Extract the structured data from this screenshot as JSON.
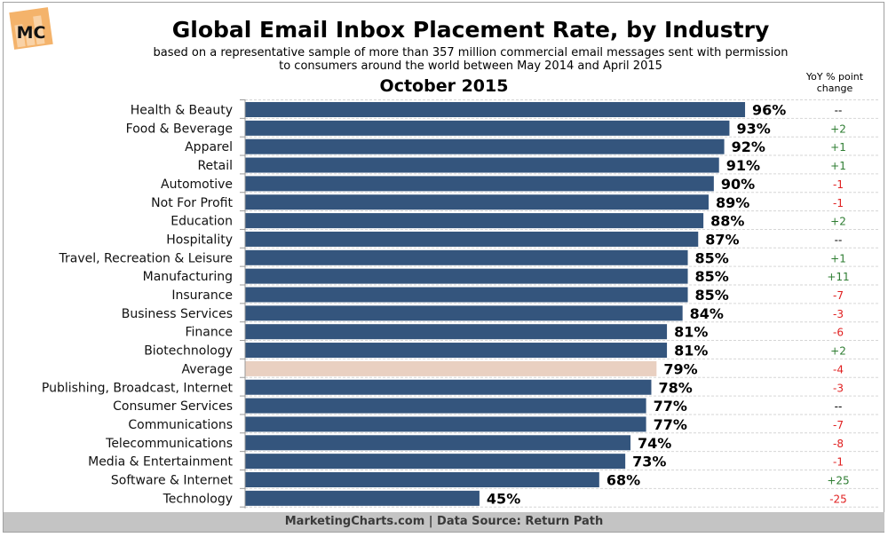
{
  "header": {
    "logo_text": "MC",
    "title": "Global Email Inbox Placement Rate, by Industry",
    "subtitle_line1": "based on a representative sample of more than 357 million commercial email messages sent with permission",
    "subtitle_line2": "to consumers around the world between May 2014 and April 2015",
    "period": "October 2015",
    "yoy_header_line1": "YoY % point",
    "yoy_header_line2": "change"
  },
  "footer": {
    "text": "MarketingCharts.com | Data Source: Return Path"
  },
  "colors": {
    "bar": "#34557d",
    "average_bar": "#e9d0c1",
    "positive": "#2e7d32",
    "negative": "#e02020",
    "neutral": "#000000"
  },
  "chart_data": {
    "type": "bar",
    "orientation": "horizontal",
    "title": "Global Email Inbox Placement Rate, by Industry",
    "subtitle": "based on a representative sample of more than 357 million commercial email messages sent with permission to consumers around the world between May 2014 and April 2015",
    "period": "October 2015",
    "xlabel": "",
    "ylabel": "",
    "xlim": [
      0,
      100
    ],
    "unit": "%",
    "grid": false,
    "highlight_category": "Average",
    "categories": [
      "Health & Beauty",
      "Food & Beverage",
      "Apparel",
      "Retail",
      "Automotive",
      "Not For Profit",
      "Education",
      "Hospitality",
      "Travel, Recreation & Leisure",
      "Manufacturing",
      "Insurance",
      "Business Services",
      "Finance",
      "Biotechnology",
      "Average",
      "Publishing, Broadcast, Internet",
      "Consumer Services",
      "Communications",
      "Telecommunications",
      "Media & Entertainment",
      "Software & Internet",
      "Technology"
    ],
    "values": [
      96,
      93,
      92,
      91,
      90,
      89,
      88,
      87,
      85,
      85,
      85,
      84,
      81,
      81,
      79,
      78,
      77,
      77,
      74,
      73,
      68,
      45
    ],
    "value_labels": [
      "96%",
      "93%",
      "92%",
      "91%",
      "90%",
      "89%",
      "88%",
      "87%",
      "85%",
      "85%",
      "85%",
      "84%",
      "81%",
      "81%",
      "79%",
      "78%",
      "77%",
      "77%",
      "74%",
      "73%",
      "68%",
      "45%"
    ],
    "yoy_change_header": "YoY % point change",
    "yoy_change": [
      "--",
      "+2",
      "+1",
      "+1",
      "-1",
      "-1",
      "+2",
      "--",
      "+1",
      "+11",
      "-7",
      "-3",
      "-6",
      "+2",
      "-4",
      "-3",
      "--",
      "-7",
      "-8",
      "-1",
      "+25",
      "-25"
    ]
  }
}
